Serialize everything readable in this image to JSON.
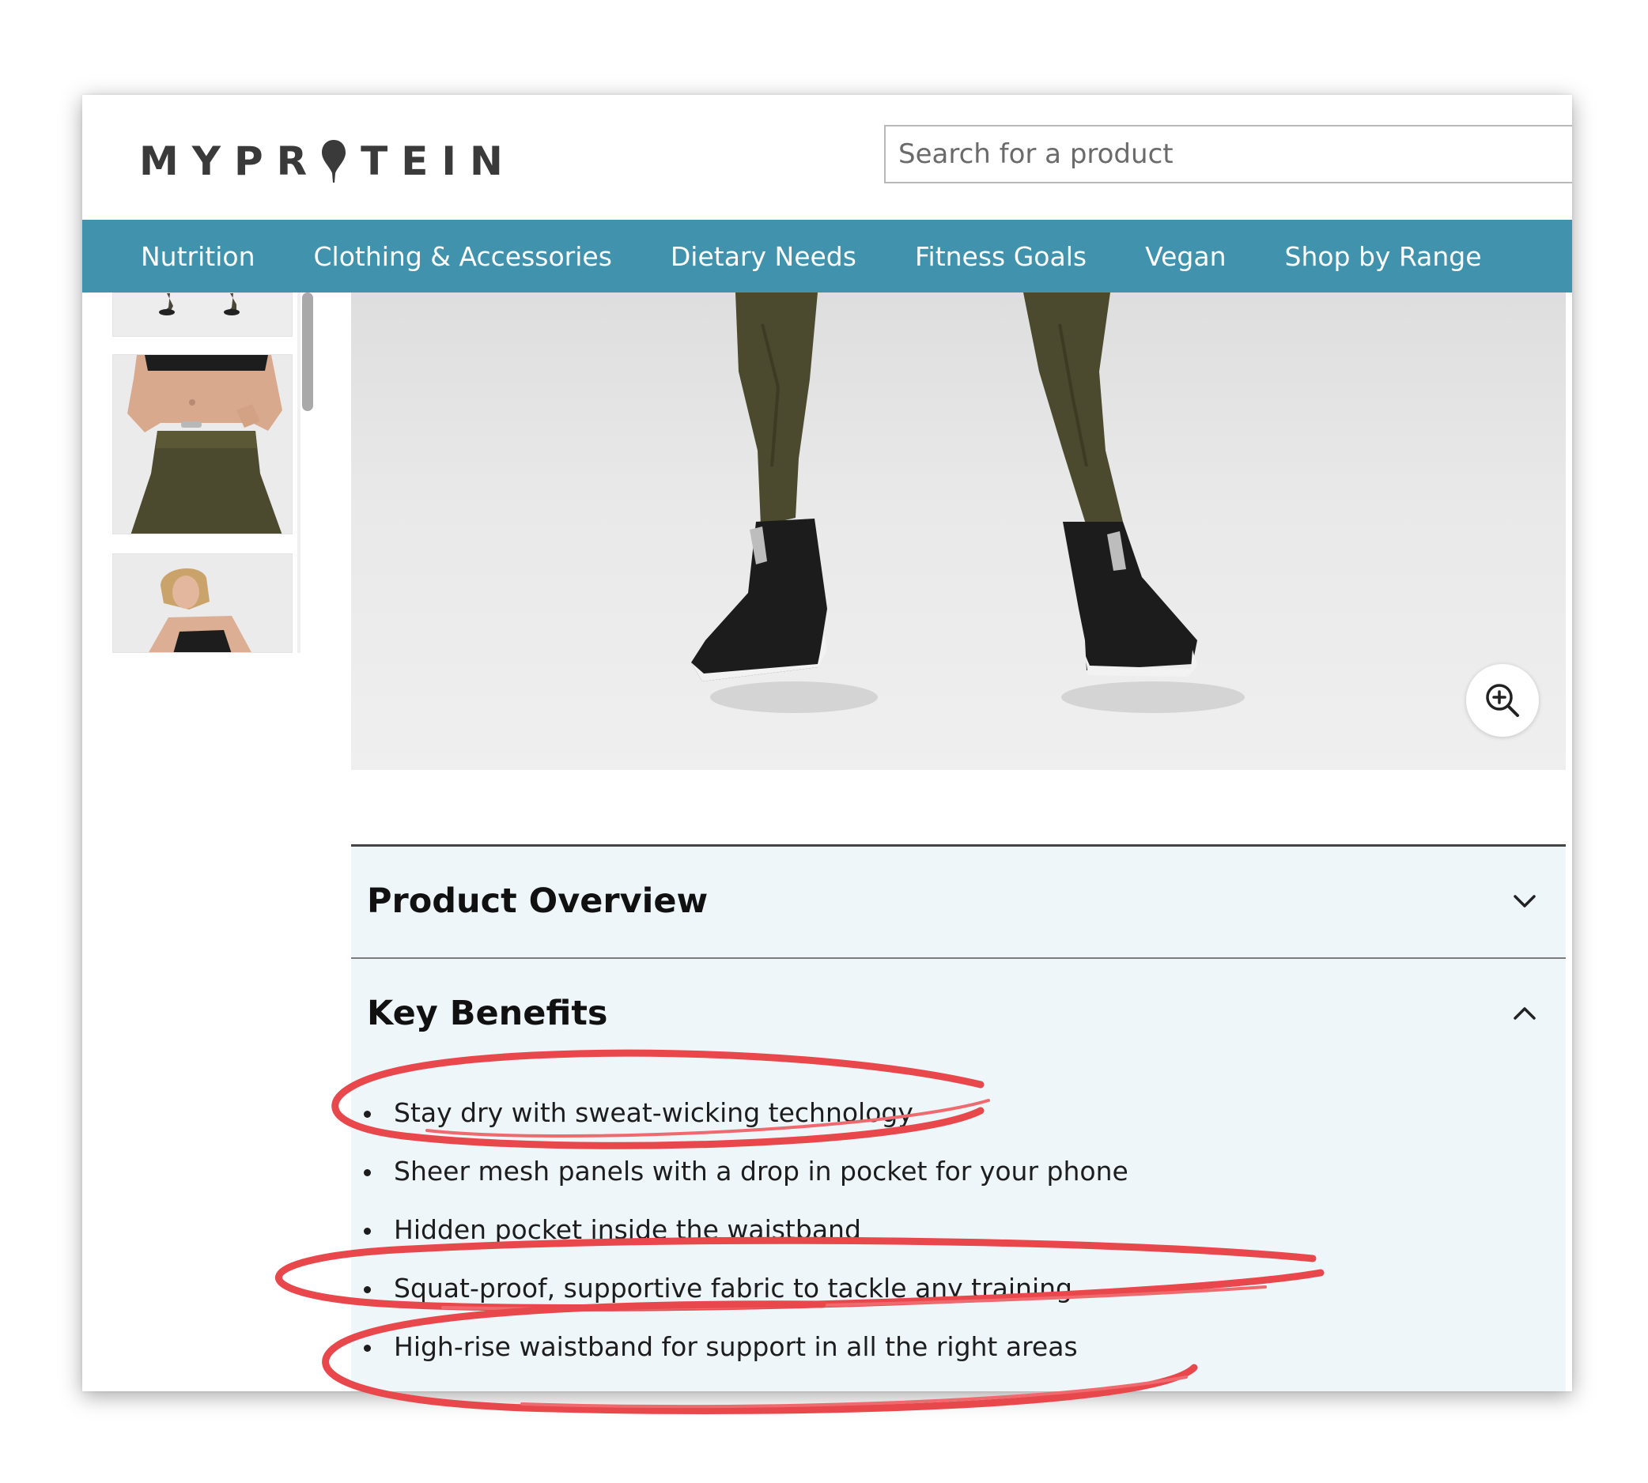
{
  "brand": {
    "logo_text": "MYPROTEIN",
    "logo_letters_left": "MYPR",
    "logo_letters_right": "TEIN",
    "accent_color": "#4193ad"
  },
  "search": {
    "placeholder": "Search for a product",
    "value": ""
  },
  "nav": {
    "items": [
      {
        "label": "Nutrition"
      },
      {
        "label": "Clothing & Accessories"
      },
      {
        "label": "Dietary Needs"
      },
      {
        "label": "Fitness Goals"
      },
      {
        "label": "Vegan"
      },
      {
        "label": "Shop by Range"
      }
    ]
  },
  "gallery": {
    "zoom_icon": "zoom-in-icon"
  },
  "accordion": {
    "sections": [
      {
        "title": "Product Overview",
        "state": "collapsed",
        "icon": "chevron-down-icon"
      },
      {
        "title": "Key Benefits",
        "state": "expanded",
        "icon": "chevron-up-icon"
      }
    ],
    "key_benefits": [
      "Stay dry with sweat-wicking technology",
      "Sheer mesh panels with a drop in pocket for your phone",
      "Hidden pocket inside the waistband",
      "Squat-proof, supportive fabric to tackle any training",
      "High-rise waistband for support in all the right areas"
    ]
  },
  "annotation": {
    "color": "#e8474c",
    "circled_benefits": [
      0,
      3,
      4
    ]
  }
}
